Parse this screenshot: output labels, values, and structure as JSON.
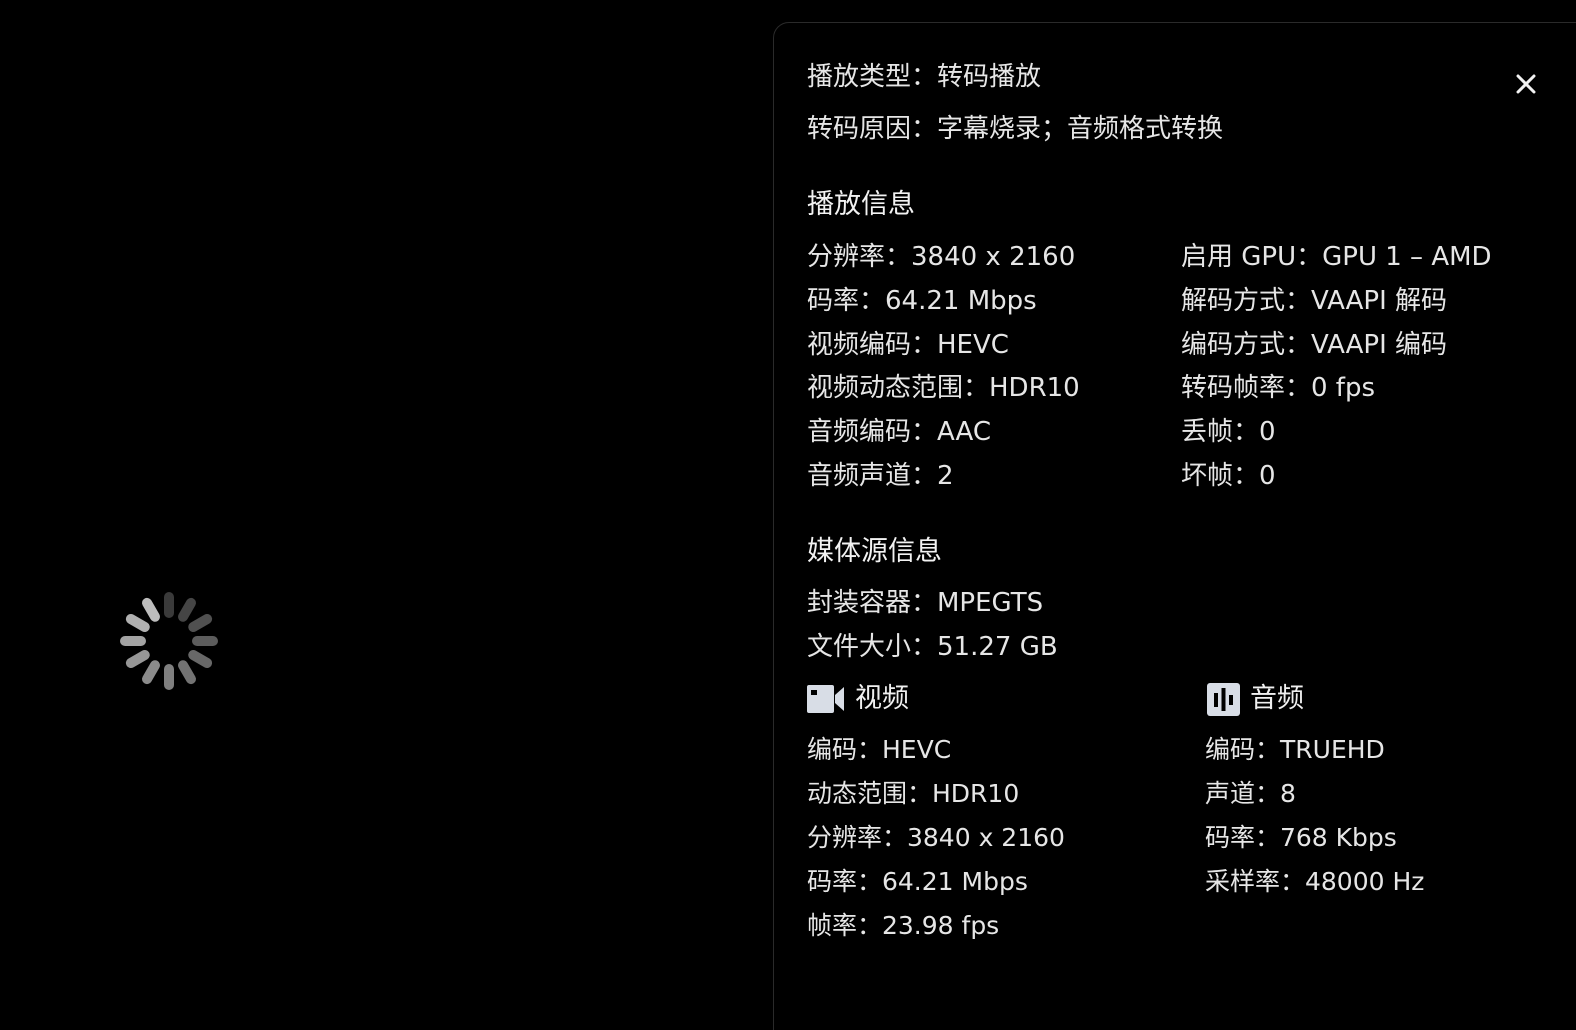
{
  "summary": {
    "play_type": "播放类型：转码播放",
    "transcode_reason": "转码原因：字幕烧录；音频格式转换"
  },
  "playback": {
    "title": "播放信息",
    "left": [
      "分辨率：3840 x 2160",
      "码率：64.21 Mbps",
      "视频编码：HEVC",
      "视频动态范围：HDR10",
      "音频编码：AAC",
      "音频声道：2"
    ],
    "right": [
      "启用 GPU：GPU 1 – AMD",
      "解码方式：VAAPI 解码",
      "编码方式：VAAPI 编码",
      "转码帧率：0 fps",
      "丢帧：0",
      "坏帧：0"
    ]
  },
  "source": {
    "title": "媒体源信息",
    "lines": [
      "封装容器：MPEGTS",
      "文件大小：51.27 GB"
    ]
  },
  "video": {
    "title": "视频",
    "icon": "video-camera-icon",
    "lines": [
      "编码：HEVC",
      "动态范围：HDR10",
      "分辨率：3840 x 2160",
      "码率：64.21 Mbps",
      "帧率：23.98 fps"
    ]
  },
  "audio": {
    "title": "音频",
    "icon": "audio-wave-icon",
    "lines": [
      "编码：TRUEHD",
      "声道：8",
      "码率：768 Kbps",
      "采样率：48000 Hz"
    ]
  },
  "colors": {
    "background": "#000000",
    "text": "#e6e6e6",
    "panel_border": "#2a2a2a",
    "icon_fill": "#d8dde6"
  }
}
